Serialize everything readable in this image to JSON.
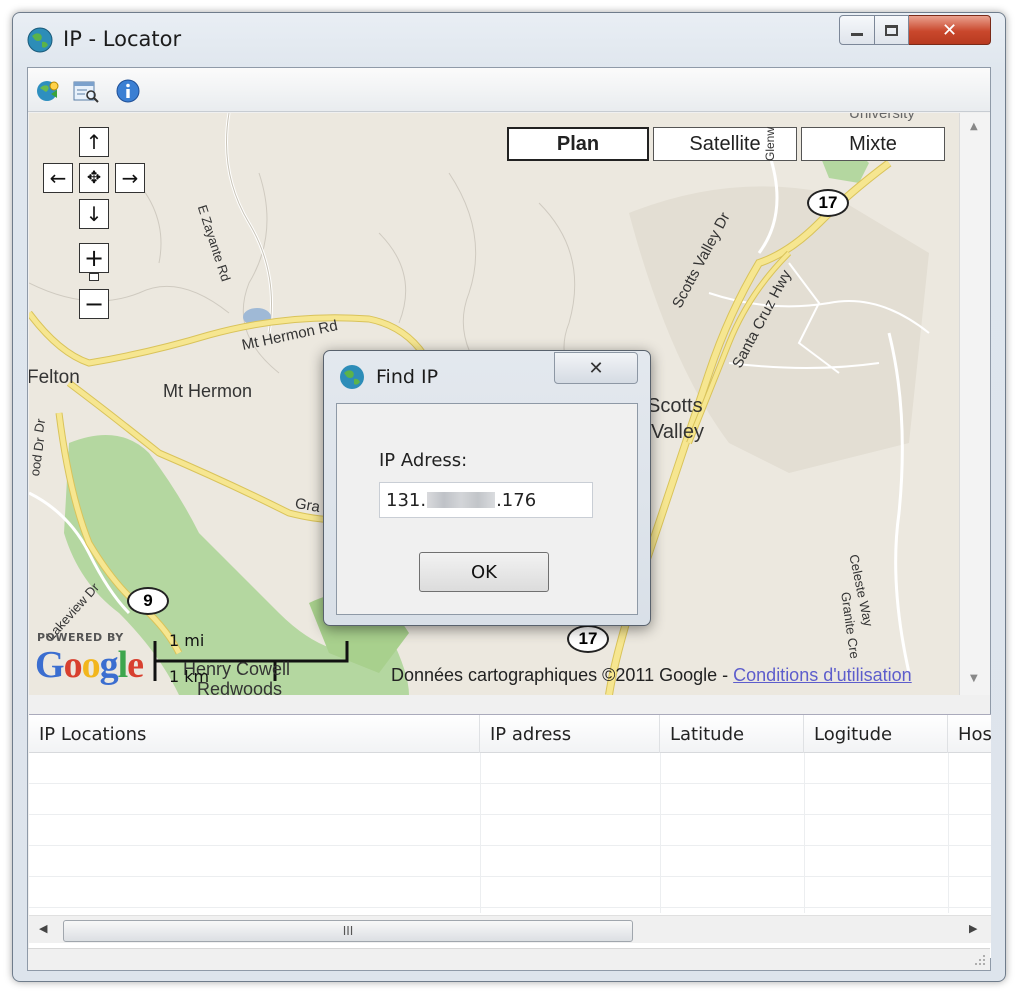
{
  "window": {
    "title": "IP - Locator",
    "controls": {
      "minimize": "▭",
      "maximize": "⧉",
      "close": "✕"
    }
  },
  "toolbar": {
    "icons": [
      "locate-icon",
      "find-ip-icon",
      "info-icon"
    ]
  },
  "map": {
    "type_buttons": [
      "Plan",
      "Satellite",
      "Mixte"
    ],
    "active_type": "Plan",
    "nav": {
      "up": "↑",
      "down": "↓",
      "left": "←",
      "right": "→",
      "center": "✥",
      "zoom_in": "+",
      "zoom_out": "−"
    },
    "places": {
      "felton": "Felton",
      "mt_hermon": "Mt Hermon",
      "scotts": "Scotts",
      "valley": "Valley",
      "henry_cowell": "Henry Cowell",
      "redwoods": "Redwoods",
      "university": "University"
    },
    "roads": {
      "mt_hermon_rd": "Mt Hermon Rd",
      "scotts_valley_dr": "Scotts Valley Dr",
      "santa_cruz_hwy": "Santa Cruz Hwy",
      "e_zayante_rd": "E Zayante Rd",
      "lakeview_dr": "Lakeview Dr",
      "glenwood": "Glenw",
      "celeste_way": "Celeste Way",
      "granite_creek": "Granite Cre",
      "graham": "Gra",
      "wood_dr": "ood Dr",
      "dr": "Dr"
    },
    "shields": {
      "hwy17_top": "17",
      "hwy17_bottom": "17",
      "hwy9": "9"
    },
    "powered_by": "POWERED BY",
    "google_logo": "Google",
    "scale_mi": "1 mi",
    "scale_km": "1 km",
    "copyright_text": "Données cartographiques ©2011 Google - ",
    "copyright_link": "Conditions d'utilisation"
  },
  "grid": {
    "columns": [
      "IP Locations",
      "IP adress",
      "Latitude",
      "Logitude",
      "Hos"
    ],
    "rows": [],
    "scroll_thumb": "III",
    "scroll_left": "◀",
    "scroll_right": "▶"
  },
  "dialog": {
    "title": "Find IP",
    "close": "✕",
    "label": "IP Adress:",
    "ip_prefix": "131.",
    "ip_suffix": ".176",
    "ok_label": "OK"
  },
  "colors": {
    "accent_close": "#c9472c",
    "map_bg": "#ece8df",
    "road_yellow": "#f5e06a",
    "park_green": "#a8d08d"
  }
}
